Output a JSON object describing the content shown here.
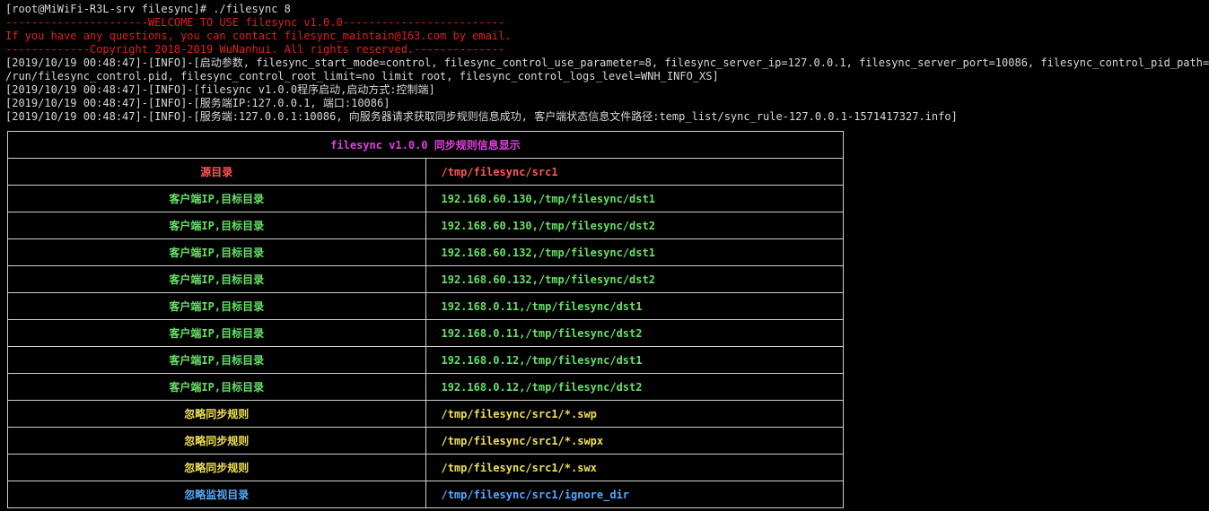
{
  "terminal": {
    "prompt_line": "[root@MiWiFi-R3L-srv filesync]# ./filesync 8",
    "banner_welcome": "----------------------WELCOME TO USE filesync v1.0.0-------------------------",
    "banner_contact": "If you have any questions, you can contact filesync_maintain@163.com by email.",
    "banner_copyright": "-------------Copyright 2018-2019 WuNanhui. All rights reserved.--------------",
    "log_lines": [
      "[2019/10/19 00:48:47]-[INFO]-[启动参数, filesync_start_mode=control, filesync_control_use_parameter=8, filesync_server_ip=127.0.0.1, filesync_server_port=10086, filesync_control_pid_path=/var",
      "/run/filesync_control.pid, filesync_control_root_limit=no limit root, filesync_control_logs_level=WNH_INFO_XS]",
      "[2019/10/19 00:48:47]-[INFO]-[filesync v1.0.0程序启动,启动方式:控制端]",
      "[2019/10/19 00:48:47]-[INFO]-[服务端IP:127.0.0.1, 端口:10086]",
      "[2019/10/19 00:48:47]-[INFO]-[服务端:127.0.0.1:10086, 向服务器请求获取同步规则信息成功, 客户端状态信息文件路径:temp_list/sync_rule-127.0.0.1-1571417327.info]"
    ]
  },
  "sync_table": {
    "title": "filesync v1.0.0 同步规则信息显示",
    "rows": [
      {
        "label": "源目录",
        "value": "/tmp/filesync/src1"
      },
      {
        "label": "客户端IP,目标目录",
        "value": "192.168.60.130,/tmp/filesync/dst1"
      },
      {
        "label": "客户端IP,目标目录",
        "value": "192.168.60.130,/tmp/filesync/dst2"
      },
      {
        "label": "客户端IP,目标目录",
        "value": "192.168.60.132,/tmp/filesync/dst1"
      },
      {
        "label": "客户端IP,目标目录",
        "value": "192.168.60.132,/tmp/filesync/dst2"
      },
      {
        "label": "客户端IP,目标目录",
        "value": "192.168.0.11,/tmp/filesync/dst1"
      },
      {
        "label": "客户端IP,目标目录",
        "value": "192.168.0.11,/tmp/filesync/dst2"
      },
      {
        "label": "客户端IP,目标目录",
        "value": "192.168.0.12,/tmp/filesync/dst1"
      },
      {
        "label": "客户端IP,目标目录",
        "value": "192.168.0.12,/tmp/filesync/dst2"
      },
      {
        "label": "忽略同步规则",
        "value": "/tmp/filesync/src1/*.swp"
      },
      {
        "label": "忽略同步规则",
        "value": "/tmp/filesync/src1/*.swpx"
      },
      {
        "label": "忽略同步规则",
        "value": "/tmp/filesync/src1/*.swx"
      },
      {
        "label": "忽略监视目录",
        "value": "/tmp/filesync/src1/ignore_dir"
      }
    ]
  },
  "colors": {
    "background": "#000000",
    "banner_red": "#e11f1f",
    "title_magenta": "#e040e0",
    "source_red": "#ff5555",
    "client_green": "#66e066",
    "ignore_yellow": "#f0e050",
    "monitor_blue": "#55aaff"
  }
}
